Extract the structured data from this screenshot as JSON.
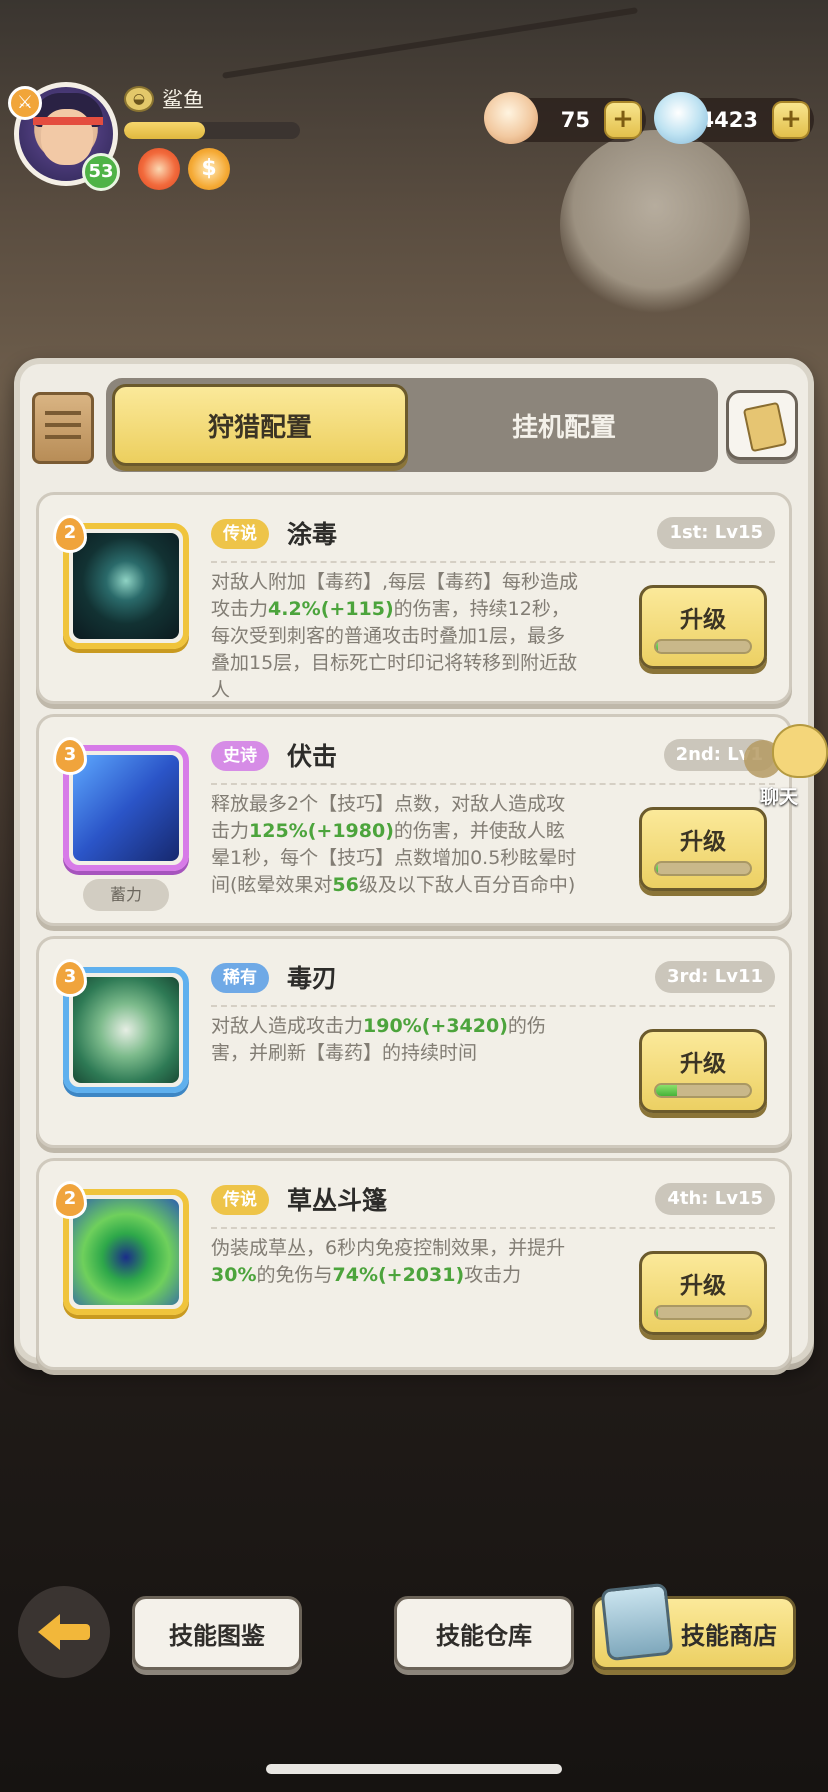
{
  "player": {
    "name": "鲨鱼",
    "level": "53",
    "exp_fraction": 0.46,
    "rank_icon": "fish-rank-icon",
    "status_icons": [
      "fire-buff-icon",
      "coin-buff-icon"
    ]
  },
  "currencies": {
    "shell": {
      "value": "75",
      "icon": "shell-icon"
    },
    "gem": {
      "value": "4423",
      "icon": "gem-icon"
    },
    "plus": "+"
  },
  "tabs": {
    "active": "狩猎配置",
    "inactive": "挂机配置"
  },
  "skills": [
    {
      "stars": "2",
      "rarity": "传说",
      "rarity_color": "#eec449",
      "name": "涂毒",
      "rank": "1st: Lv15",
      "desc_parts": [
        {
          "t": "对敌人附加【毒药】,每层【毒药】每秒造成攻击力"
        },
        {
          "t": "4.2%(+115)",
          "g": true
        },
        {
          "t": "的伤害，持续12秒，每次受到刺客的普通攻击时叠加1层，最多叠加15层，目标死亡时印记将转移到附近敌人"
        }
      ],
      "upgrade_label": "升级",
      "upgrade_progress": 0.02
    },
    {
      "stars": "3",
      "rarity": "史诗",
      "rarity_color": "#d68ce6",
      "name": "伏击",
      "rank": "2nd: Lv1",
      "charge_tag": "蓄力",
      "desc_parts": [
        {
          "t": "释放最多2个【技巧】点数，对敌人造成攻击力"
        },
        {
          "t": "125%(+1980)",
          "g": true
        },
        {
          "t": "的伤害，并使敌人眩晕1秒，每个【技巧】点数增加0.5秒眩晕时间(眩晕效果对"
        },
        {
          "t": "56",
          "g": true
        },
        {
          "t": "级及以下敌人百分百命中)"
        }
      ],
      "upgrade_label": "升级",
      "upgrade_progress": 0.02
    },
    {
      "stars": "3",
      "rarity": "稀有",
      "rarity_color": "#6fa9e6",
      "name": "毒刃",
      "rank": "3rd: Lv11",
      "desc_parts": [
        {
          "t": "对敌人造成攻击力"
        },
        {
          "t": "190%(+3420)",
          "g": true
        },
        {
          "t": "的伤害，并刷新【毒药】的持续时间"
        }
      ],
      "upgrade_label": "升级",
      "upgrade_progress": 0.22
    },
    {
      "stars": "2",
      "rarity": "传说",
      "rarity_color": "#eec449",
      "name": "草丛斗篷",
      "rank": "4th: Lv15",
      "desc_parts": [
        {
          "t": "伪装成草丛，6秒内免疫控制效果，并提升"
        },
        {
          "t": "30%",
          "g": true
        },
        {
          "t": "的免伤与"
        },
        {
          "t": "74%(+2031)",
          "g": true
        },
        {
          "t": "攻击力"
        }
      ],
      "upgrade_label": "升级",
      "upgrade_progress": 0.02
    }
  ],
  "chat": {
    "label": "聊天"
  },
  "bottom": {
    "atlas": "技能图鉴",
    "storage": "技能仓库",
    "shop": "技能商店"
  }
}
